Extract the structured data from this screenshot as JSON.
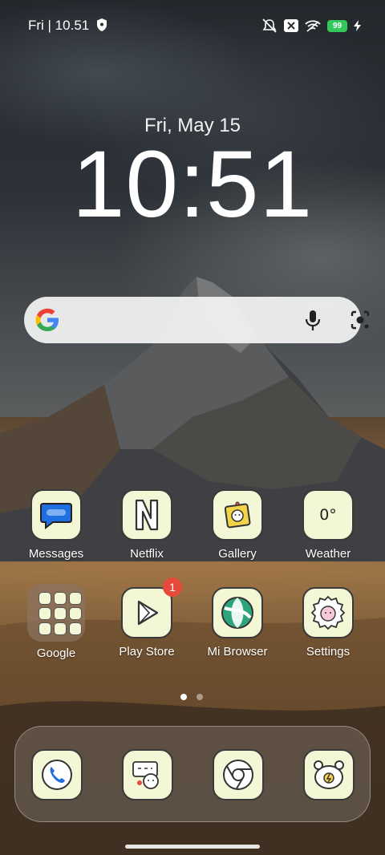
{
  "status_bar": {
    "time": "Fri | 10.51",
    "battery_level": "99",
    "icons": [
      "shield-icon",
      "mute-icon",
      "close-box-icon",
      "wifi-icon",
      "battery-icon",
      "charging-icon"
    ]
  },
  "lockscreen": {
    "date": "Fri, May 15",
    "clock": "10:51"
  },
  "search_bar": {
    "icons": [
      "google-logo-icon",
      "microphone-icon",
      "lens-camera-icon"
    ]
  },
  "apps_row1": [
    {
      "label": "Messages",
      "icon": "messages-icon"
    },
    {
      "label": "Netflix",
      "icon": "netflix-icon"
    },
    {
      "label": "Gallery",
      "icon": "gallery-icon"
    },
    {
      "label": "Weather",
      "icon": "weather-icon",
      "value": "0°"
    }
  ],
  "apps_row2": [
    {
      "label": "Google",
      "icon": "folder-icon"
    },
    {
      "label": "Play Store",
      "icon": "play-store-icon",
      "badge": "1"
    },
    {
      "label": "Mi Browser",
      "icon": "mi-browser-icon"
    },
    {
      "label": "Settings",
      "icon": "settings-icon"
    }
  ],
  "page_indicator": {
    "pages": 2,
    "current": 1
  },
  "dock": [
    {
      "icon": "phone-icon"
    },
    {
      "icon": "contacts-icon"
    },
    {
      "icon": "chrome-icon"
    },
    {
      "icon": "themes-icon"
    }
  ],
  "colors": {
    "tile_bg": "#f4f7d6",
    "badge": "#e64a3b",
    "battery": "#34c759"
  }
}
